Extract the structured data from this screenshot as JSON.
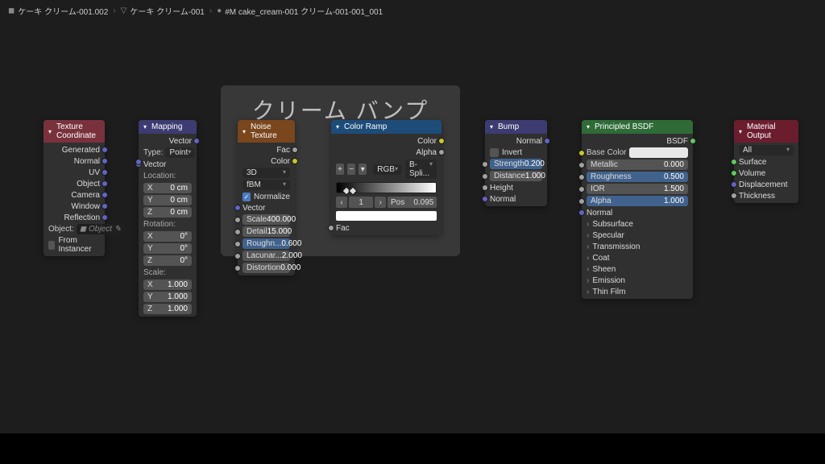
{
  "breadcrumb": [
    {
      "label": "ケーキ クリーム-001.002",
      "icon": "◼"
    },
    {
      "label": "ケーキ クリーム-001",
      "icon": "▽"
    },
    {
      "label": "#M cake_cream-001 クリーム-001-001_001",
      "icon": "●"
    }
  ],
  "frame": {
    "title": "クリーム バンプ"
  },
  "nodes": {
    "texcoord": {
      "title": "Texture Coordinate",
      "outputs": [
        "Generated",
        "Normal",
        "UV",
        "Object",
        "Camera",
        "Window",
        "Reflection"
      ],
      "object_label": "Object:",
      "object_placeholder": "Object",
      "from_instancer": "From Instancer"
    },
    "mapping": {
      "title": "Mapping",
      "vector_out": "Vector",
      "type_label": "Type:",
      "type_value": "Point",
      "vector_in": "Vector",
      "location_label": "Location:",
      "loc": [
        {
          "axis": "X",
          "val": "0 cm"
        },
        {
          "axis": "Y",
          "val": "0 cm"
        },
        {
          "axis": "Z",
          "val": "0 cm"
        }
      ],
      "rotation_label": "Rotation:",
      "rot": [
        {
          "axis": "X",
          "val": "0°"
        },
        {
          "axis": "Y",
          "val": "0°"
        },
        {
          "axis": "Z",
          "val": "0°"
        }
      ],
      "scale_label": "Scale:",
      "scl": [
        {
          "axis": "X",
          "val": "1.000"
        },
        {
          "axis": "Y",
          "val": "1.000"
        },
        {
          "axis": "Z",
          "val": "1.000"
        }
      ]
    },
    "noise": {
      "title": "Noise Texture",
      "fac_out": "Fac",
      "color_out": "Color",
      "dim": "3D",
      "type": "fBM",
      "normalize": "Normalize",
      "vector_in": "Vector",
      "props": [
        {
          "lbl": "Scale",
          "val": "400.000",
          "blue": false
        },
        {
          "lbl": "Detail",
          "val": "15.000",
          "blue": false
        },
        {
          "lbl": "Roughn...",
          "val": "0.600",
          "blue": true
        },
        {
          "lbl": "Lacunar...",
          "val": "2.000",
          "blue": false
        },
        {
          "lbl": "Distortion",
          "val": "0.000",
          "blue": false
        }
      ]
    },
    "ramp": {
      "title": "Color Ramp",
      "color_out": "Color",
      "alpha_out": "Alpha",
      "mode1": "RGB",
      "mode2": "B-Spli...",
      "stop_index": "1",
      "pos_label": "Pos",
      "pos_value": "0.095",
      "fac_in": "Fac"
    },
    "bump": {
      "title": "Bump",
      "normal_out": "Normal",
      "invert": "Invert",
      "strength": {
        "lbl": "Strength",
        "val": "0.200"
      },
      "distance": {
        "lbl": "Distance",
        "val": "1.000"
      },
      "height_in": "Height",
      "normal_in": "Normal"
    },
    "bsdf": {
      "title": "Principled BSDF",
      "bsdf_out": "BSDF",
      "base_color": "Base Color",
      "props": [
        {
          "lbl": "Metallic",
          "val": "0.000",
          "blue": false
        },
        {
          "lbl": "Roughness",
          "val": "0.500",
          "blue": true
        },
        {
          "lbl": "IOR",
          "val": "1.500",
          "blue": false
        },
        {
          "lbl": "Alpha",
          "val": "1.000",
          "blue": true
        }
      ],
      "normal_in": "Normal",
      "groups": [
        "Subsurface",
        "Specular",
        "Transmission",
        "Coat",
        "Sheen",
        "Emission",
        "Thin Film"
      ]
    },
    "output": {
      "title": "Material Output",
      "target": "All",
      "inputs": [
        "Surface",
        "Volume",
        "Displacement",
        "Thickness"
      ]
    }
  }
}
